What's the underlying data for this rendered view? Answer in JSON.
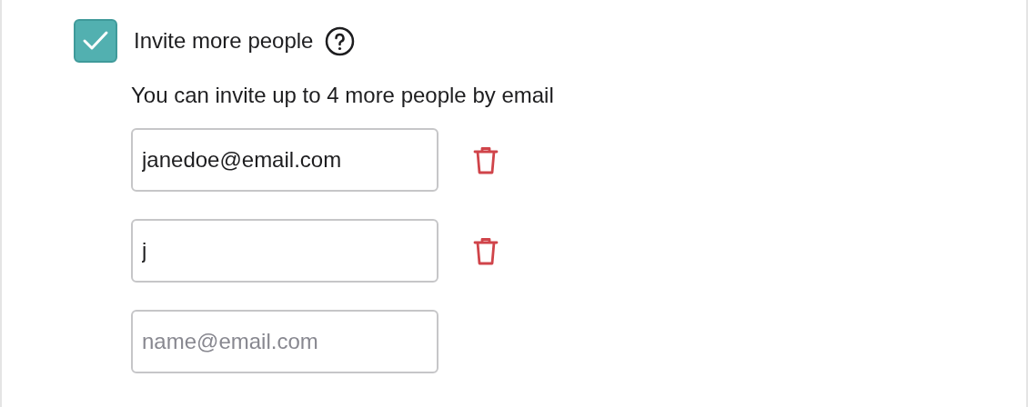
{
  "invite": {
    "label": "Invite more people",
    "checked": true,
    "hint": "You can invite up to 4 more people by email"
  },
  "emails": [
    {
      "value": "janedoe@email.com",
      "removable": true
    },
    {
      "value": "j",
      "removable": true
    },
    {
      "placeholder": "name@email.com",
      "removable": false
    }
  ]
}
